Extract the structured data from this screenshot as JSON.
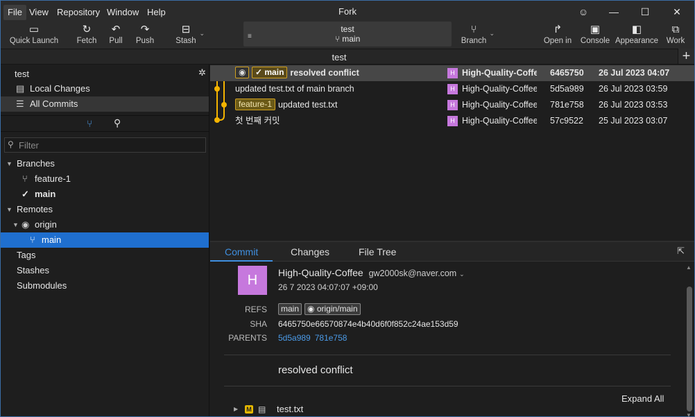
{
  "app": {
    "title": "Fork"
  },
  "menu": [
    "File",
    "View",
    "Repository",
    "Window",
    "Help"
  ],
  "window_controls": {
    "feedback": "☺",
    "minimize": "—",
    "maximize": "☐",
    "close": "✕"
  },
  "toolbar": {
    "quick_launch": "Quick Launch",
    "fetch": "Fetch",
    "pull": "Pull",
    "push": "Push",
    "stash": "Stash",
    "branch": "Branch",
    "open_in": "Open in",
    "console": "Console",
    "appearance": "Appearance",
    "work": "Work"
  },
  "repo_selector": {
    "repo": "test",
    "branch": "main"
  },
  "tab": {
    "title": "test"
  },
  "sidebar": {
    "repo_name": "test",
    "local_changes": "Local Changes",
    "all_commits": "All Commits",
    "filter_placeholder": "Filter",
    "branches": "Branches",
    "feature_branch": "feature-1",
    "main_branch": "main",
    "remotes": "Remotes",
    "origin": "origin",
    "origin_main": "main",
    "tags": "Tags",
    "stashes": "Stashes",
    "submodules": "Submodules"
  },
  "commits": [
    {
      "message": "resolved conflict",
      "tags": [
        "main"
      ],
      "author": "High-Quality-Coffee",
      "sha": "6465750",
      "date": "26 Jul 2023 04:07"
    },
    {
      "message": "updated test.txt of main branch",
      "tags": [],
      "author": "High-Quality-Coffee",
      "sha": "5d5a989",
      "date": "26 Jul 2023 03:59"
    },
    {
      "message": "updated test.txt",
      "tags": [
        "feature-1"
      ],
      "author": "High-Quality-Coffee",
      "sha": "781e758",
      "date": "26 Jul 2023 03:53"
    },
    {
      "message": "첫 번째 커밋",
      "tags": [],
      "author": "High-Quality-Coffee",
      "sha": "57c9522",
      "date": "25 Jul 2023 03:07"
    }
  ],
  "avatar_letter": "H",
  "details": {
    "tabs": [
      "Commit",
      "Changes",
      "File Tree"
    ],
    "author": "High-Quality-Coffee",
    "email": "gw2000sk@naver.com",
    "date": "26 7 2023 04:07:07 +09:00",
    "refs_label": "REFS",
    "refs": [
      "main",
      "origin/main"
    ],
    "sha_label": "SHA",
    "sha": "6465750e66570874e4b40d6f0f852c24ae153d59",
    "parents_label": "PARENTS",
    "parents": [
      "5d5a989",
      "781e758"
    ],
    "message": "resolved conflict",
    "expand_all": "Expand All",
    "file_badge": "M",
    "file": "test.txt"
  },
  "colors": {
    "accent": "#1f6fcf",
    "graph": "#f5b400",
    "avatar": "#c678dd",
    "link": "#4b9be8"
  }
}
